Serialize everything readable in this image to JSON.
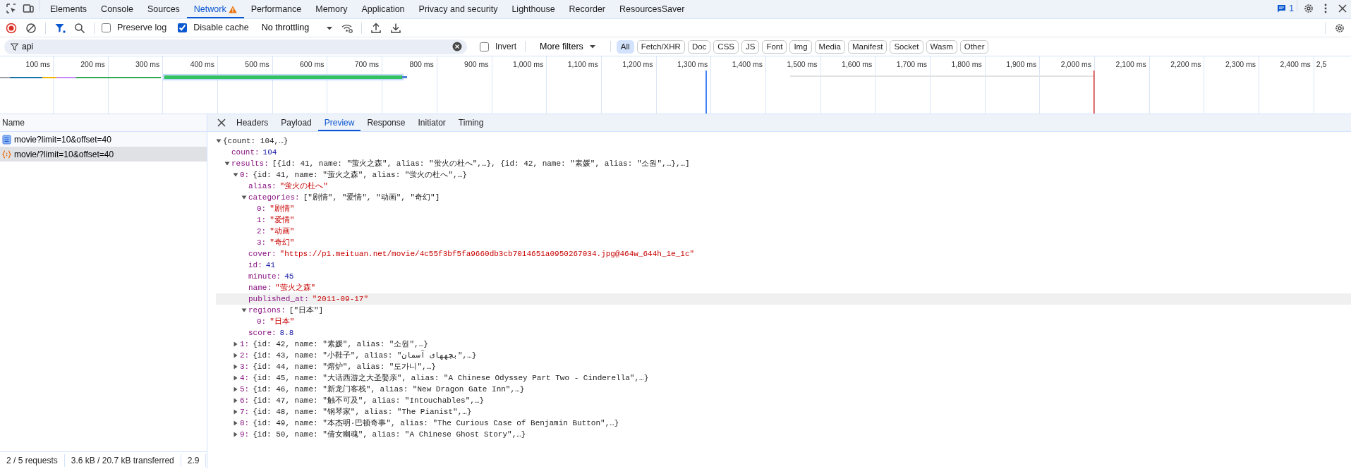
{
  "main_tabs": [
    {
      "label": "Elements",
      "selected": false,
      "warning": false
    },
    {
      "label": "Console",
      "selected": false,
      "warning": false
    },
    {
      "label": "Sources",
      "selected": false,
      "warning": false
    },
    {
      "label": "Network",
      "selected": true,
      "warning": true
    },
    {
      "label": "Performance",
      "selected": false,
      "warning": false
    },
    {
      "label": "Memory",
      "selected": false,
      "warning": false
    },
    {
      "label": "Application",
      "selected": false,
      "warning": false
    },
    {
      "label": "Privacy and security",
      "selected": false,
      "warning": false
    },
    {
      "label": "Lighthouse",
      "selected": false,
      "warning": false
    },
    {
      "label": "Recorder",
      "selected": false,
      "warning": false
    },
    {
      "label": "ResourcesSaver",
      "selected": false,
      "warning": false
    }
  ],
  "issues_count": "1",
  "toolbar": {
    "recording": true,
    "filter_active": true,
    "checkboxes": [
      {
        "label": "Preserve log",
        "checked": false
      },
      {
        "label": "Disable cache",
        "checked": true
      }
    ],
    "throttling": "No throttling"
  },
  "filter_bar": {
    "value": "api",
    "invert": {
      "label": "Invert",
      "checked": false
    },
    "more_filters": "More filters",
    "types": [
      {
        "label": "All",
        "selected": true
      },
      {
        "label": "Fetch/XHR",
        "selected": false
      },
      {
        "label": "Doc",
        "selected": false
      },
      {
        "label": "CSS",
        "selected": false
      },
      {
        "label": "JS",
        "selected": false
      },
      {
        "label": "Font",
        "selected": false
      },
      {
        "label": "Img",
        "selected": false
      },
      {
        "label": "Media",
        "selected": false
      },
      {
        "label": "Manifest",
        "selected": false
      },
      {
        "label": "Socket",
        "selected": false
      },
      {
        "label": "Wasm",
        "selected": false
      },
      {
        "label": "Other",
        "selected": false
      }
    ]
  },
  "timeline": {
    "ticks": [
      "100 ms",
      "200 ms",
      "300 ms",
      "400 ms",
      "500 ms",
      "600 ms",
      "700 ms",
      "800 ms",
      "900 ms",
      "1,000 ms",
      "1,100 ms",
      "1,200 ms",
      "1,300 ms",
      "1,400 ms",
      "1,500 ms",
      "1,600 ms",
      "1,700 ms",
      "1,800 ms",
      "1,900 ms",
      "2,000 ms",
      "2,100 ms",
      "2,200 ms",
      "2,300 ms",
      "2,400 ms",
      "2,5"
    ]
  },
  "requests": {
    "header": "Name",
    "rows": [
      {
        "name": "movie?limit=10&offset=40",
        "kind": "document",
        "selected": false
      },
      {
        "name": "movie/?limit=10&offset=40",
        "kind": "fetch",
        "selected": true
      }
    ]
  },
  "status_bar": [
    "2 / 5 requests",
    "3.6 kB / 20.7 kB transferred",
    "2.9"
  ],
  "detail_tabs": [
    {
      "label": "Headers",
      "selected": false
    },
    {
      "label": "Payload",
      "selected": false
    },
    {
      "label": "Preview",
      "selected": true
    },
    {
      "label": "Response",
      "selected": false
    },
    {
      "label": "Initiator",
      "selected": false
    },
    {
      "label": "Timing",
      "selected": false
    }
  ],
  "preview": {
    "summary": "{count: 104,…}",
    "expanded": true,
    "children": [
      {
        "key": "count:",
        "value": "104",
        "kind": "number"
      },
      {
        "key": "results:",
        "summary": "[{id: 41, name: \"萤火之森\", alias: \"蛍火の杜へ\",…}, {id: 42, name: \"素媛\", alias: \"소원\",…},…]",
        "expanded": true,
        "children": [
          {
            "key": "0:",
            "summary": "{id: 41, name: \"萤火之森\", alias: \"蛍火の杜へ\",…}",
            "expanded": true,
            "children": [
              {
                "key": "alias:",
                "value": "\"蛍火の杜へ\"",
                "kind": "string",
                "hovered": false
              },
              {
                "key": "categories:",
                "summary": "[\"剧情\", \"爱情\", \"动画\", \"奇幻\"]",
                "expanded": true,
                "hovered": false,
                "children": [
                  {
                    "key": "0:",
                    "value": "\"剧情\"",
                    "kind": "string"
                  },
                  {
                    "key": "1:",
                    "value": "\"爱情\"",
                    "kind": "string"
                  },
                  {
                    "key": "2:",
                    "value": "\"动画\"",
                    "kind": "string"
                  },
                  {
                    "key": "3:",
                    "value": "\"奇幻\"",
                    "kind": "string"
                  }
                ]
              },
              {
                "key": "cover:",
                "value": "\"https://p1.meituan.net/movie/4c55f3bf5fa9660db3cb7014651a0950267034.jpg@464w_644h_1e_1c\"",
                "kind": "string",
                "hovered": false
              },
              {
                "key": "id:",
                "value": "41",
                "kind": "number",
                "hovered": false
              },
              {
                "key": "minute:",
                "value": "45",
                "kind": "number",
                "hovered": false
              },
              {
                "key": "name:",
                "value": "\"萤火之森\"",
                "kind": "string",
                "hovered": false
              },
              {
                "key": "published_at:",
                "value": "\"2011-09-17\"",
                "kind": "string",
                "hovered": true
              },
              {
                "key": "regions:",
                "summary": "[\"日本\"]",
                "expanded": true,
                "hovered": false,
                "children": [
                  {
                    "key": "0:",
                    "value": "\"日本\"",
                    "kind": "string"
                  }
                ]
              },
              {
                "key": "score:",
                "value": "8.8",
                "kind": "number",
                "hovered": false
              }
            ]
          },
          {
            "key": "1:",
            "summary": "{id: 42, name: \"素媛\", alias: \"소원\",…}",
            "expanded": false
          },
          {
            "key": "2:",
            "summary": "{id: 43, name: \"小鞋子\", alias: \"بچههای آسمان\",…}",
            "expanded": false
          },
          {
            "key": "3:",
            "summary": "{id: 44, name: \"熔炉\", alias: \"도가니\",…}",
            "expanded": false
          },
          {
            "key": "4:",
            "summary": "{id: 45, name: \"大话西游之大圣娶亲\", alias: \"A Chinese Odyssey Part Two - Cinderella\",…}",
            "expanded": false
          },
          {
            "key": "5:",
            "summary": "{id: 46, name: \"新龙门客栈\", alias: \"New Dragon Gate Inn\",…}",
            "expanded": false
          },
          {
            "key": "6:",
            "summary": "{id: 47, name: \"触不可及\", alias: \"Intouchables\",…}",
            "expanded": false
          },
          {
            "key": "7:",
            "summary": "{id: 48, name: \"钢琴家\", alias: \"The Pianist\",…}",
            "expanded": false
          },
          {
            "key": "8:",
            "summary": "{id: 49, name: \"本杰明·巴顿奇事\", alias: \"The Curious Case of Benjamin Button\",…}",
            "expanded": false
          },
          {
            "key": "9:",
            "summary": "{id: 50, name: \"倩女幽魂\", alias: \"A Chinese Ghost Story\",…}",
            "expanded": false
          }
        ]
      }
    ]
  }
}
